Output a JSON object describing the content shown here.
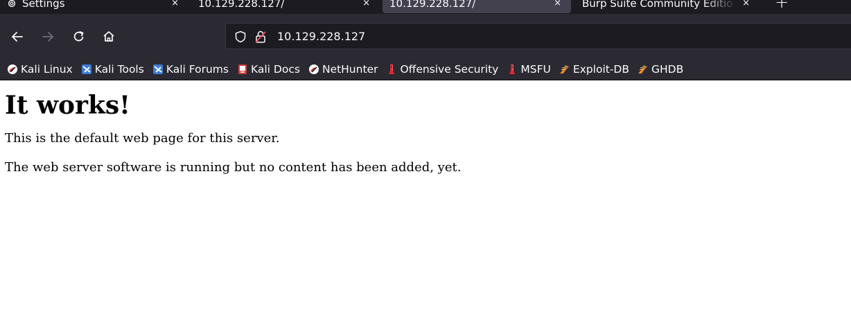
{
  "tabs": [
    {
      "title": "Settings",
      "icon": "gear-icon",
      "active": false
    },
    {
      "title": "10.129.228.127/",
      "active": false
    },
    {
      "title": "10.129.228.127/",
      "active": true
    },
    {
      "title": "Burp Suite Community Editio",
      "active": false
    }
  ],
  "tab_close_glyph": "×",
  "newtab_glyph": "+",
  "navbar": {
    "url": "10.129.228.127"
  },
  "bookmarks": [
    {
      "label": "Kali Linux",
      "icon": "kali-dragon-icon"
    },
    {
      "label": "Kali Tools",
      "icon": "kali-tools-icon"
    },
    {
      "label": "Kali Forums",
      "icon": "kali-forums-icon"
    },
    {
      "label": "Kali Docs",
      "icon": "kali-docs-icon"
    },
    {
      "label": "NetHunter",
      "icon": "nethunter-icon"
    },
    {
      "label": "Offensive Security",
      "icon": "offsec-icon"
    },
    {
      "label": "MSFU",
      "icon": "msfu-icon"
    },
    {
      "label": "Exploit-DB",
      "icon": "exploit-db-icon"
    },
    {
      "label": "GHDB",
      "icon": "ghdb-icon"
    }
  ],
  "page": {
    "heading": "It works!",
    "paragraph1": "This is the default web page for this server.",
    "paragraph2": "The web server software is running but no content has been added, yet."
  },
  "colors": {
    "tabstrip_bg": "#1c1b22",
    "toolbar_bg": "#2b2a33",
    "active_tab_bg": "#42414d",
    "text_light": "#fbfbfe",
    "kali_red": "#d33b3b",
    "kali_blue": "#3a7bd5",
    "offsec_red": "#e0262b",
    "exploitdb_orange": "#f28c28"
  }
}
